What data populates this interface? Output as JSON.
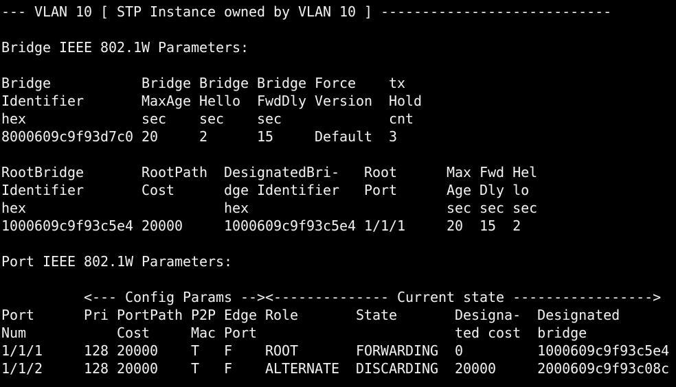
{
  "terminal": {
    "lines": [
      "--- VLAN 10 [ STP Instance owned by VLAN 10 ] ----------------------------",
      "",
      "Bridge IEEE 802.1W Parameters:",
      "",
      "Bridge           Bridge Bridge Bridge Force    tx",
      "Identifier       MaxAge Hello  FwdDly Version  Hold",
      "hex              sec    sec    sec             cnt",
      "8000609c9f93d7c0 20     2      15     Default  3",
      "",
      "RootBridge       RootPath  DesignatedBri-   Root      Max Fwd Hel",
      "Identifier       Cost      dge Identifier   Port      Age Dly lo",
      "hex                        hex                        sec sec sec",
      "1000609c9f93c5e4 20000     1000609c9f93c5e4 1/1/1     20  15  2",
      "",
      "Port IEEE 802.1W Parameters:",
      "",
      "          <--- Config Params --><-------------- Current state ----------------->",
      "Port      Pri PortPath P2P Edge Role       State       Designa-  Designated",
      "Num           Cost     Mac Port                        ted cost  bridge",
      "1/1/1     128 20000    T   F    ROOT       FORWARDING  0         1000609c9f93c5e4",
      "1/1/2     128 20000    T   F    ALTERNATE  DISCARDING  20000     2000609c9f93c08c"
    ]
  }
}
